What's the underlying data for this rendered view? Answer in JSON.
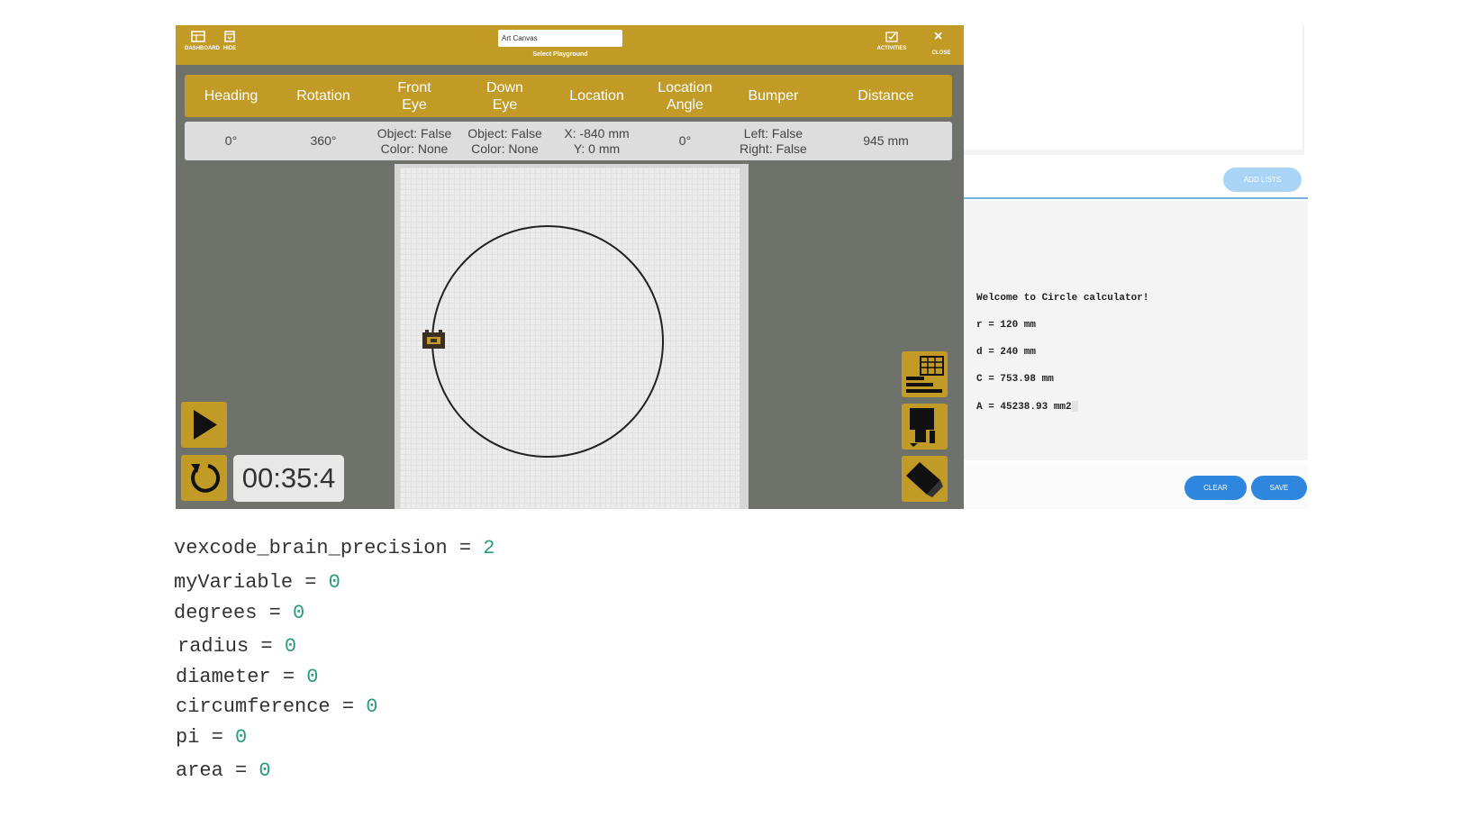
{
  "toolbar": {
    "buttons": [
      {
        "label": "DASHBOARD",
        "icon": "dashboard-icon"
      },
      {
        "label": "HIDE",
        "icon": "hide-icon"
      }
    ],
    "playground_value": "Art Canvas",
    "playground_label": "Select Playground",
    "activities_label": "ACTIVITIES",
    "activities_icon": "activities-icon",
    "close_label": "CLOSE",
    "close_icon": "close-icon"
  },
  "dashboard": {
    "headers": [
      [
        "Heading"
      ],
      [
        "Rotation"
      ],
      [
        "Front",
        "Eye"
      ],
      [
        "Down",
        "Eye"
      ],
      [
        "Location"
      ],
      [
        "Location",
        "Angle"
      ],
      [
        "Bumper"
      ],
      [
        "Distance"
      ]
    ],
    "values": [
      [
        "0°"
      ],
      [
        "360°"
      ],
      [
        "Object: False",
        "Color: None"
      ],
      [
        "Object: False",
        "Color: None"
      ],
      [
        "X: -840 mm",
        "Y: 0 mm"
      ],
      [
        "0°"
      ],
      [
        "Left: False",
        "Right: False"
      ],
      [
        "945 mm"
      ]
    ]
  },
  "playground": {
    "name": "Art Canvas",
    "circle_radius_mm": 120,
    "robot_icon": "robot-icon"
  },
  "controls": {
    "play_icon": "play-icon",
    "reset_icon": "reset-icon",
    "timer": "00:35:4",
    "side_icons": [
      "data-table-icon",
      "pen-icon",
      "eraser-icon"
    ]
  },
  "output": {
    "add_lists_label": "ADD LISTS",
    "console_lines": [
      "Welcome to Circle calculator!",
      "r = 120 mm",
      "d = 240 mm",
      "C = 753.98 mm",
      "A = 45238.93 mm2"
    ],
    "clear_label": "CLEAR",
    "save_label": "SAVE"
  },
  "code": [
    {
      "name": "vexcode_brain_precision",
      "op": "=",
      "value": "2"
    },
    {
      "name": "myVariable",
      "op": "=",
      "value": "0"
    },
    {
      "name": "degrees",
      "op": "=",
      "value": "0"
    },
    {
      "name": "radius",
      "op": "=",
      "value": "0"
    },
    {
      "name": "diameter",
      "op": "=",
      "value": "0"
    },
    {
      "name": "circumference",
      "op": "=",
      "value": "0"
    },
    {
      "name": "pi",
      "op": "=",
      "value": "0"
    },
    {
      "name": "area",
      "op": "=",
      "value": "0"
    }
  ],
  "colors": {
    "toolbar_gold": "#c29a26",
    "panel_gray": "#6f716b",
    "button_blue": "#2e86de",
    "code_number": "#2a9d7f"
  }
}
